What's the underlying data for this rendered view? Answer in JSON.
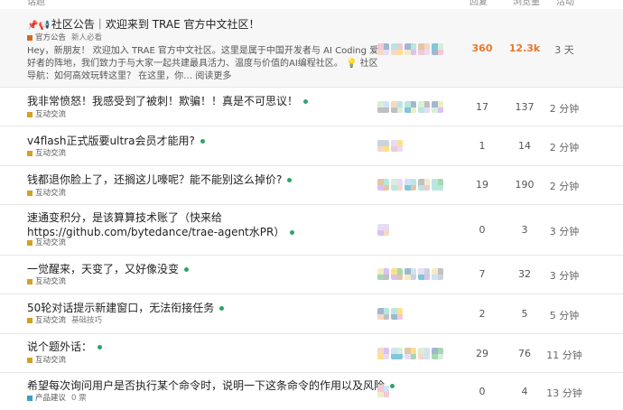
{
  "header": {
    "col_topic": "话题",
    "col_replies": "回复",
    "col_views": "浏览量",
    "col_activity": "活动"
  },
  "topics": [
    {
      "title": "社区公告｜欢迎来到 TRAE 官方中文社区！",
      "pinned_icons": "📌📢",
      "category": "官方公告",
      "category_color": "#d46a1e",
      "tag": "新人必看",
      "excerpt": "Hey，新朋友！ 欢迎加入 TRAE 官方中文社区。这里是属于中国开发者与 AI Coding 爱好者的阵地，我们致力于与大家一起共建最具活力、温度与价值的AI编程社区。 💡 社区导航：如何高效玩转这里？ 在这里，你… 阅读更多",
      "replies": "360",
      "views": "12.3k",
      "activity": "3 天",
      "hot": true
    },
    {
      "title": "我非常愤怒！我感受到了被刺！欺骗！！真是不可思议！",
      "category": "互动交流",
      "category_color": "#d4a020",
      "tag": "",
      "replies": "17",
      "views": "137",
      "activity": "2 分钟"
    },
    {
      "title": "v4flash正式版要ultra会员才能用?",
      "category": "互动交流",
      "category_color": "#d4a020",
      "tag": "",
      "replies": "1",
      "views": "14",
      "activity": "2 分钟"
    },
    {
      "title": "钱都退你脸上了，还搁这儿嚎呢？能不能别这么掉价?",
      "category": "互动交流",
      "category_color": "#d4a020",
      "tag": "",
      "replies": "19",
      "views": "190",
      "activity": "2 分钟"
    },
    {
      "title": "速通变积分，是该算算技术账了（快来给https://github.com/bytedance/trae-agent水PR）",
      "category": "互动交流",
      "category_color": "#d4a020",
      "tag": "",
      "replies": "0",
      "views": "3",
      "activity": "3 分钟"
    },
    {
      "title": "一觉醒来，天变了，又好像没变",
      "category": "互动交流",
      "category_color": "#d4a020",
      "tag": "",
      "replies": "7",
      "views": "32",
      "activity": "3 分钟"
    },
    {
      "title": "50轮对话提示新建窗口，无法衔接任务",
      "category": "互动交流",
      "category_color": "#d4a020",
      "tag": "基础技巧",
      "replies": "2",
      "views": "5",
      "activity": "5 分钟"
    },
    {
      "title": "说个题外话：",
      "category": "互动交流",
      "category_color": "#d4a020",
      "tag": "",
      "replies": "29",
      "views": "76",
      "activity": "11 分钟"
    },
    {
      "title": "希望每次询问用户是否执行某个命令时，说明一下这条命令的作用以及风险",
      "category": "产品建议",
      "category_color": "#3aa0c9",
      "tag": "0 票",
      "replies": "0",
      "views": "4",
      "activity": "13 分钟"
    }
  ]
}
